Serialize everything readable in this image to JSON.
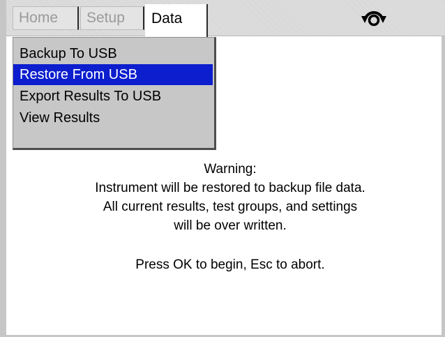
{
  "tabs": [
    {
      "label": "Home",
      "state": "inactive"
    },
    {
      "label": "Setup",
      "state": "inactive"
    },
    {
      "label": "Data",
      "state": "active"
    }
  ],
  "header": {
    "icon": "rotate-device-icon"
  },
  "menu": {
    "items": [
      {
        "label": "Backup To USB",
        "selected": false
      },
      {
        "label": "Restore From USB",
        "selected": true
      },
      {
        "label": "Export Results To USB",
        "selected": false
      },
      {
        "label": "View Results",
        "selected": false
      }
    ]
  },
  "message": {
    "lines": [
      "Warning:",
      "Instrument will be restored to backup file data.",
      "All current results, test groups, and settings",
      "will be over written.",
      "Press OK to begin, Esc to abort."
    ]
  },
  "colors": {
    "selection": "#0c1ecd",
    "menu_bg": "#c7c7c7",
    "frame": "#c6c6c6"
  }
}
